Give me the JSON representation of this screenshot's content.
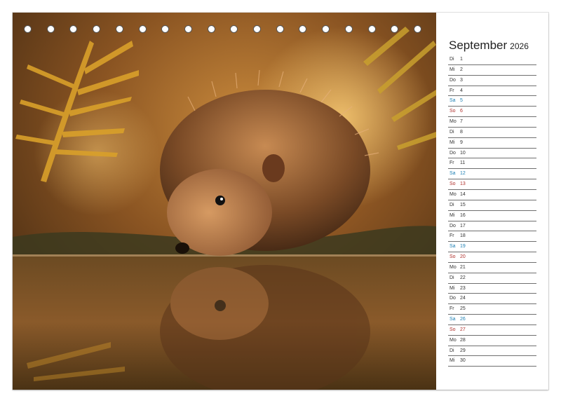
{
  "calendar": {
    "month": "September",
    "year": "2026",
    "days": [
      {
        "wd": "Di",
        "d": "1",
        "type": "weekday"
      },
      {
        "wd": "Mi",
        "d": "2",
        "type": "weekday"
      },
      {
        "wd": "Do",
        "d": "3",
        "type": "weekday"
      },
      {
        "wd": "Fr",
        "d": "4",
        "type": "weekday"
      },
      {
        "wd": "Sa",
        "d": "5",
        "type": "sat"
      },
      {
        "wd": "So",
        "d": "6",
        "type": "sun"
      },
      {
        "wd": "Mo",
        "d": "7",
        "type": "weekday"
      },
      {
        "wd": "Di",
        "d": "8",
        "type": "weekday"
      },
      {
        "wd": "Mi",
        "d": "9",
        "type": "weekday"
      },
      {
        "wd": "Do",
        "d": "10",
        "type": "weekday"
      },
      {
        "wd": "Fr",
        "d": "11",
        "type": "weekday"
      },
      {
        "wd": "Sa",
        "d": "12",
        "type": "sat"
      },
      {
        "wd": "So",
        "d": "13",
        "type": "sun"
      },
      {
        "wd": "Mo",
        "d": "14",
        "type": "weekday"
      },
      {
        "wd": "Di",
        "d": "15",
        "type": "weekday"
      },
      {
        "wd": "Mi",
        "d": "16",
        "type": "weekday"
      },
      {
        "wd": "Do",
        "d": "17",
        "type": "weekday"
      },
      {
        "wd": "Fr",
        "d": "18",
        "type": "weekday"
      },
      {
        "wd": "Sa",
        "d": "19",
        "type": "sat"
      },
      {
        "wd": "So",
        "d": "20",
        "type": "sun"
      },
      {
        "wd": "Mo",
        "d": "21",
        "type": "weekday"
      },
      {
        "wd": "Di",
        "d": "22",
        "type": "weekday"
      },
      {
        "wd": "Mi",
        "d": "23",
        "type": "weekday"
      },
      {
        "wd": "Do",
        "d": "24",
        "type": "weekday"
      },
      {
        "wd": "Fr",
        "d": "25",
        "type": "weekday"
      },
      {
        "wd": "Sa",
        "d": "26",
        "type": "sat"
      },
      {
        "wd": "So",
        "d": "27",
        "type": "sun"
      },
      {
        "wd": "Mo",
        "d": "28",
        "type": "weekday"
      },
      {
        "wd": "Di",
        "d": "29",
        "type": "weekday"
      },
      {
        "wd": "Mi",
        "d": "30",
        "type": "weekday"
      }
    ]
  },
  "binding": {
    "ring_count": 23
  },
  "colors": {
    "saturday": "#1d7fb3",
    "sunday": "#b0302c",
    "weekday": "#333333"
  },
  "photo": {
    "subject": "hedgehog-drinking-from-pond"
  }
}
